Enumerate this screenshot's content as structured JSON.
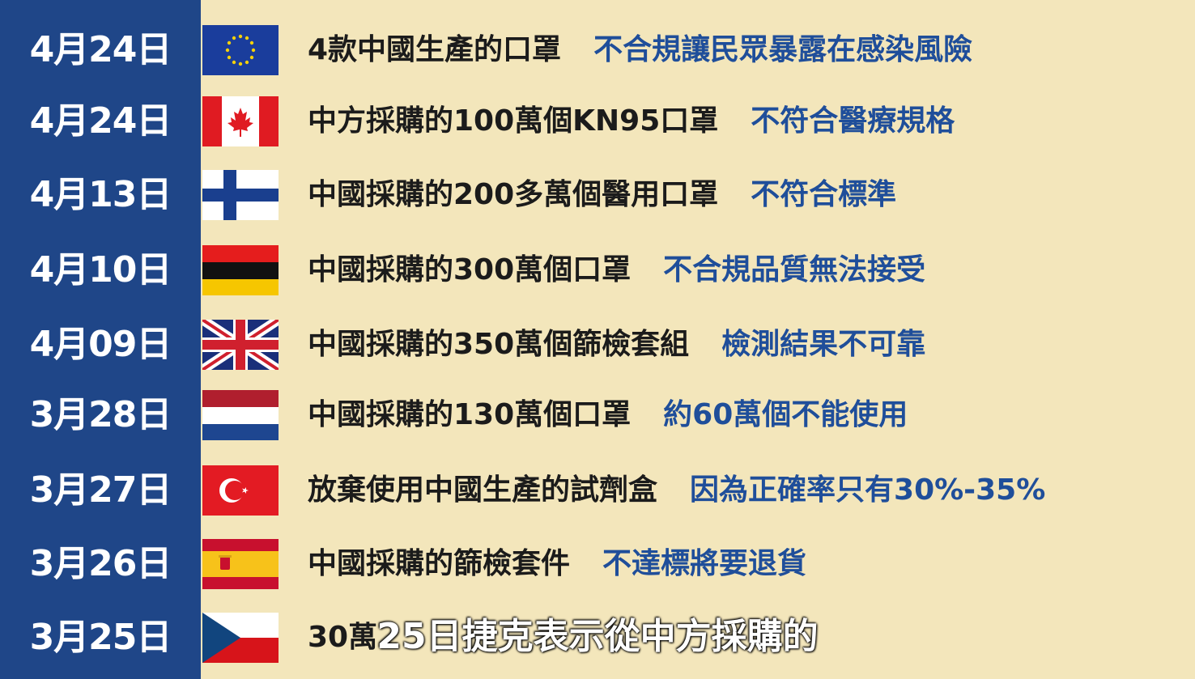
{
  "rows": [
    {
      "date": "4月24日",
      "flag": "eu-flag-icon",
      "desc": "4款中國生產的口罩",
      "note": "不合規讓民眾暴露在感染風險"
    },
    {
      "date": "4月24日",
      "flag": "canada-flag-icon",
      "desc": "中方採購的100萬個KN95口罩",
      "note": "不符合醫療規格"
    },
    {
      "date": "4月13日",
      "flag": "finland-flag-icon",
      "desc": "中國採購的200多萬個醫用口罩",
      "note": "不符合標準"
    },
    {
      "date": "4月10日",
      "flag": "germany-flag-icon",
      "desc": "中國採購的300萬個口罩",
      "note": "不合規品質無法接受"
    },
    {
      "date": "4月09日",
      "flag": "uk-flag-icon",
      "desc": "中國採購的350萬個篩檢套組",
      "note": "檢測結果不可靠"
    },
    {
      "date": "3月28日",
      "flag": "netherlands-flag-icon",
      "desc": "中國採購的130萬個口罩",
      "note": "約60萬個不能使用"
    },
    {
      "date": "3月27日",
      "flag": "turkey-flag-icon",
      "desc": "放棄使用中國生產的試劑盒",
      "note": "因為正確率只有30%-35%"
    },
    {
      "date": "3月26日",
      "flag": "spain-flag-icon",
      "desc": "中國採購的篩檢套件",
      "note": "不達標將要退貨"
    },
    {
      "date": "3月25日",
      "flag": "czech-flag-icon",
      "desc": "30萬",
      "note": ""
    }
  ],
  "subtitle": "25日捷克表示從中方採購的"
}
